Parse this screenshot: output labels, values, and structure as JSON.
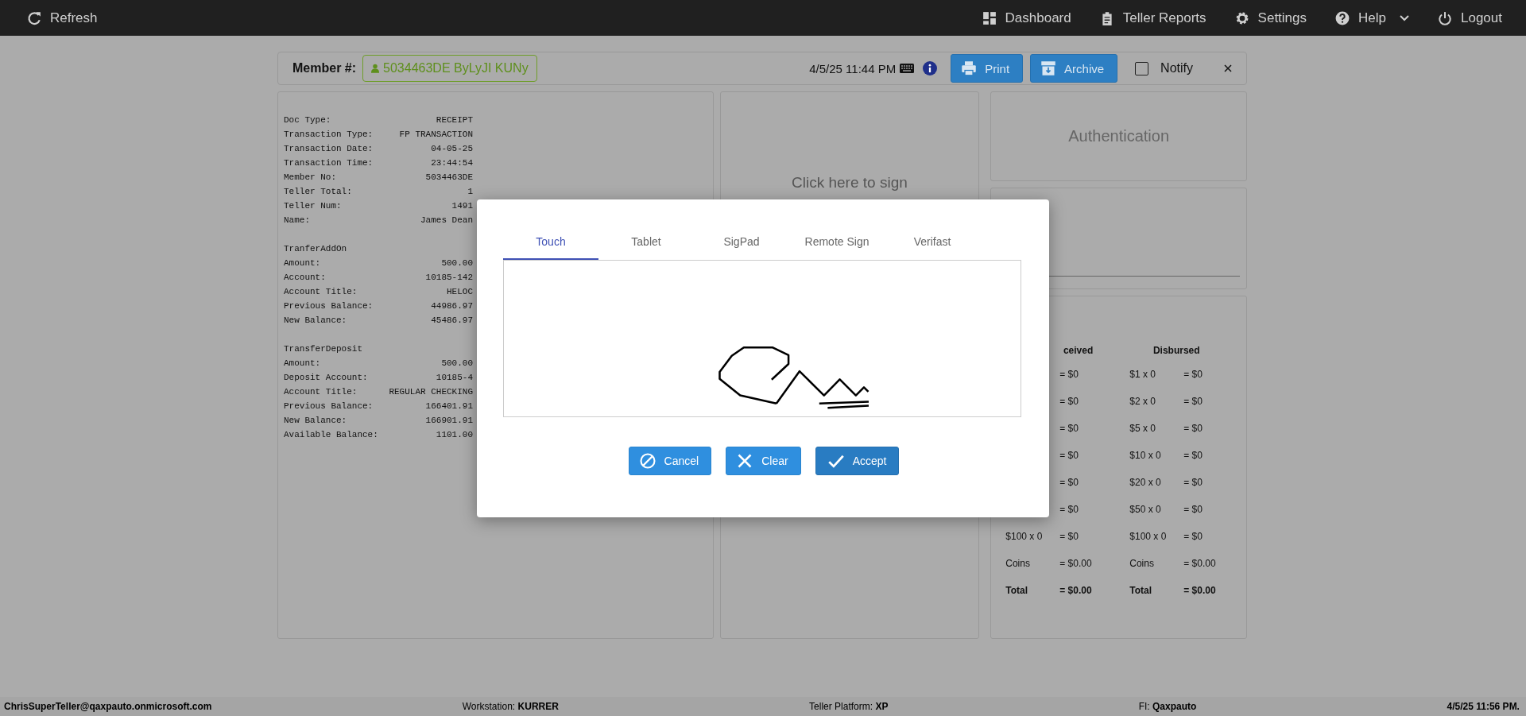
{
  "top_bar": {
    "left": [
      {
        "label": "Refresh",
        "kind": "refresh"
      }
    ],
    "right": [
      {
        "label": "Dashboard",
        "kind": "dashboard"
      },
      {
        "label": "Teller Reports",
        "kind": "clipboard"
      },
      {
        "label": "Settings",
        "kind": "gear"
      },
      {
        "label": "Help",
        "kind": "help",
        "dropdown": true
      },
      {
        "label": "Logout",
        "kind": "power"
      }
    ]
  },
  "member_bar": {
    "label": "Member #:",
    "member": "5034463DE ByLyJI KUNy",
    "datetime": "4/5/25 11:44 PM",
    "buttons": [
      {
        "label": "Print",
        "kind": "print"
      },
      {
        "label": "Archive",
        "kind": "archive"
      }
    ],
    "notify": {
      "label": "Notify",
      "checked": false
    }
  },
  "receipt": {
    "sections": [
      {
        "fields": [
          {
            "label": "Doc Type:",
            "value": "RECEIPT"
          },
          {
            "label": "Transaction Type:",
            "value": "FP TRANSACTION"
          },
          {
            "label": "Transaction Date:",
            "value": "04-05-25"
          },
          {
            "label": "Transaction Time:",
            "value": "23:44:54"
          },
          {
            "label": "Member No:",
            "value": "5034463DE"
          },
          {
            "label": "Teller Total:",
            "value": "1"
          },
          {
            "label": "Teller Num:",
            "value": "1491"
          },
          {
            "label": "Name:",
            "value": "James Dean"
          }
        ]
      },
      {
        "heading": "TranferAddOn",
        "fields": [
          {
            "label": "Amount:",
            "value": "500.00"
          },
          {
            "label": "Account:",
            "value": "10185-142"
          },
          {
            "label": "Account Title:",
            "value": "HELOC"
          },
          {
            "label": "Previous Balance:",
            "value": "44986.97"
          },
          {
            "label": "New Balance:",
            "value": "45486.97"
          }
        ]
      },
      {
        "heading": "TransferDeposit",
        "fields": [
          {
            "label": "Amount:",
            "value": "500.00"
          },
          {
            "label": "Deposit Account:",
            "value": "10185-4"
          },
          {
            "label": "Account Title:",
            "value": "REGULAR CHECKING"
          },
          {
            "label": "Previous Balance:",
            "value": "166401.91"
          },
          {
            "label": "New Balance:",
            "value": "166901.91"
          },
          {
            "label": "Available Balance:",
            "value": "1101.00"
          }
        ]
      }
    ]
  },
  "signature_panel": {
    "prompt": "Click here to sign"
  },
  "authentication": {
    "title": "Authentication"
  },
  "cash": {
    "columns": [
      {
        "header": "ceived",
        "rows": [
          {
            "amount": "= $0"
          },
          {
            "amount": "= $0"
          },
          {
            "amount": "= $0"
          },
          {
            "amount": "= $0"
          },
          {
            "amount": "= $0"
          },
          {
            "amount": "= $0"
          },
          {
            "label": "$100 x 0",
            "amount": "= $0"
          },
          {
            "label": "Coins",
            "amount": "= $0.00"
          },
          {
            "label": "Total",
            "amount": "= $0.00",
            "kind": "total"
          }
        ]
      },
      {
        "header": "Disbursed",
        "rows": [
          {
            "label": "$1 x 0",
            "amount": "= $0"
          },
          {
            "label": "$2 x 0",
            "amount": "= $0"
          },
          {
            "label": "$5 x 0",
            "amount": "= $0"
          },
          {
            "label": "$10 x 0",
            "amount": "= $0"
          },
          {
            "label": "$20 x 0",
            "amount": "= $0"
          },
          {
            "label": "$50 x 0",
            "amount": "= $0"
          },
          {
            "label": "$100 x 0",
            "amount": "= $0"
          },
          {
            "label": "Coins",
            "amount": "= $0.00"
          },
          {
            "label": "Total",
            "amount": "= $0.00",
            "kind": "total"
          }
        ]
      }
    ]
  },
  "modal": {
    "tabs": [
      {
        "label": "Touch",
        "selected": true
      },
      {
        "label": "Tablet",
        "selected": false
      },
      {
        "label": "SigPad",
        "selected": false
      },
      {
        "label": "Remote Sign",
        "selected": false
      },
      {
        "label": "Verifast",
        "selected": false
      }
    ],
    "buttons": [
      {
        "label": "Cancel",
        "kind": "cancel"
      },
      {
        "label": "Clear",
        "kind": "clear"
      },
      {
        "label": "Accept",
        "kind": "accept"
      }
    ]
  },
  "status_bar": [
    {
      "text": "ChrisSuperTeller@qaxpauto.onmicrosoft.com",
      "kind": "bold"
    },
    {
      "text": "Workstation: **KURRER**"
    },
    {
      "text": "Teller Platform: **XP**"
    },
    {
      "text": "FI: **Qaxpauto**"
    },
    {
      "text": "4/5/25 11:56 PM.",
      "kind": "bold"
    }
  ]
}
